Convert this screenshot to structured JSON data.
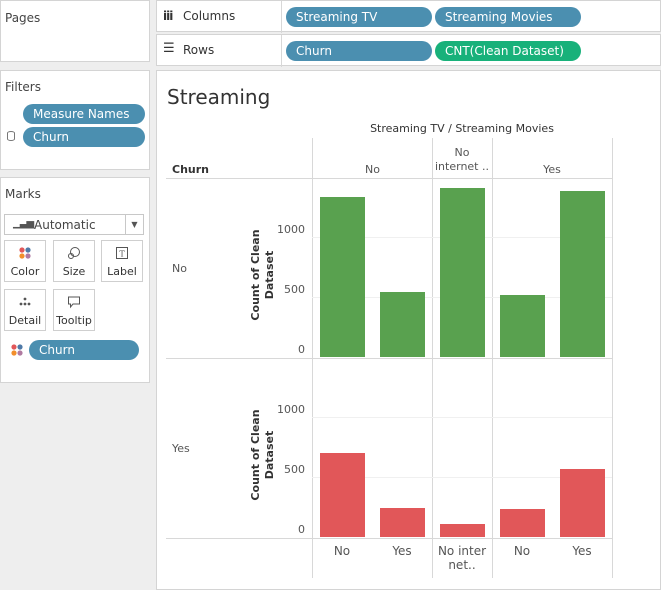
{
  "pages": {
    "title": "Pages"
  },
  "shelves": {
    "columns_label": "Columns",
    "rows_label": "Rows",
    "columns_pills": [
      "Streaming TV",
      "Streaming Movies"
    ],
    "rows_pills": [
      "Churn",
      "CNT(Clean Dataset)"
    ]
  },
  "filters": {
    "title": "Filters",
    "pills": [
      "Measure Names",
      "Churn"
    ]
  },
  "marks": {
    "title": "Marks",
    "type": "Automatic",
    "buttons": [
      "Color",
      "Size",
      "Label",
      "Detail",
      "Tooltip"
    ],
    "color_pill": "Churn"
  },
  "view": {
    "title": "Streaming",
    "col_header_title": "Streaming TV / Streaming Movies",
    "row_header_title": "Churn",
    "tv_groups": [
      "No",
      "No internet ..",
      "Yes"
    ],
    "movies_labels": [
      "No",
      "Yes",
      "No inter net..",
      "No",
      "Yes"
    ],
    "row_labels": [
      "No",
      "Yes"
    ],
    "axis_title": "Count of Clean Dataset",
    "ticks": [
      "0",
      "500",
      "1000"
    ]
  },
  "chart_data": {
    "type": "bar",
    "title": "Streaming",
    "xlabel": "Streaming TV / Streaming Movies",
    "ylabel": "Count of Clean Dataset",
    "categories": [
      "No / No",
      "No / Yes",
      "No internet / No internet",
      "Yes / No",
      "Yes / Yes"
    ],
    "series": [
      {
        "name": "No",
        "color": "#59a14f",
        "values": [
          1330,
          540,
          1410,
          520,
          1380
        ]
      },
      {
        "name": "Yes",
        "color": "#e15759",
        "values": [
          700,
          240,
          110,
          230,
          570
        ]
      }
    ],
    "ylim": [
      0,
      1500
    ],
    "grid": true
  }
}
